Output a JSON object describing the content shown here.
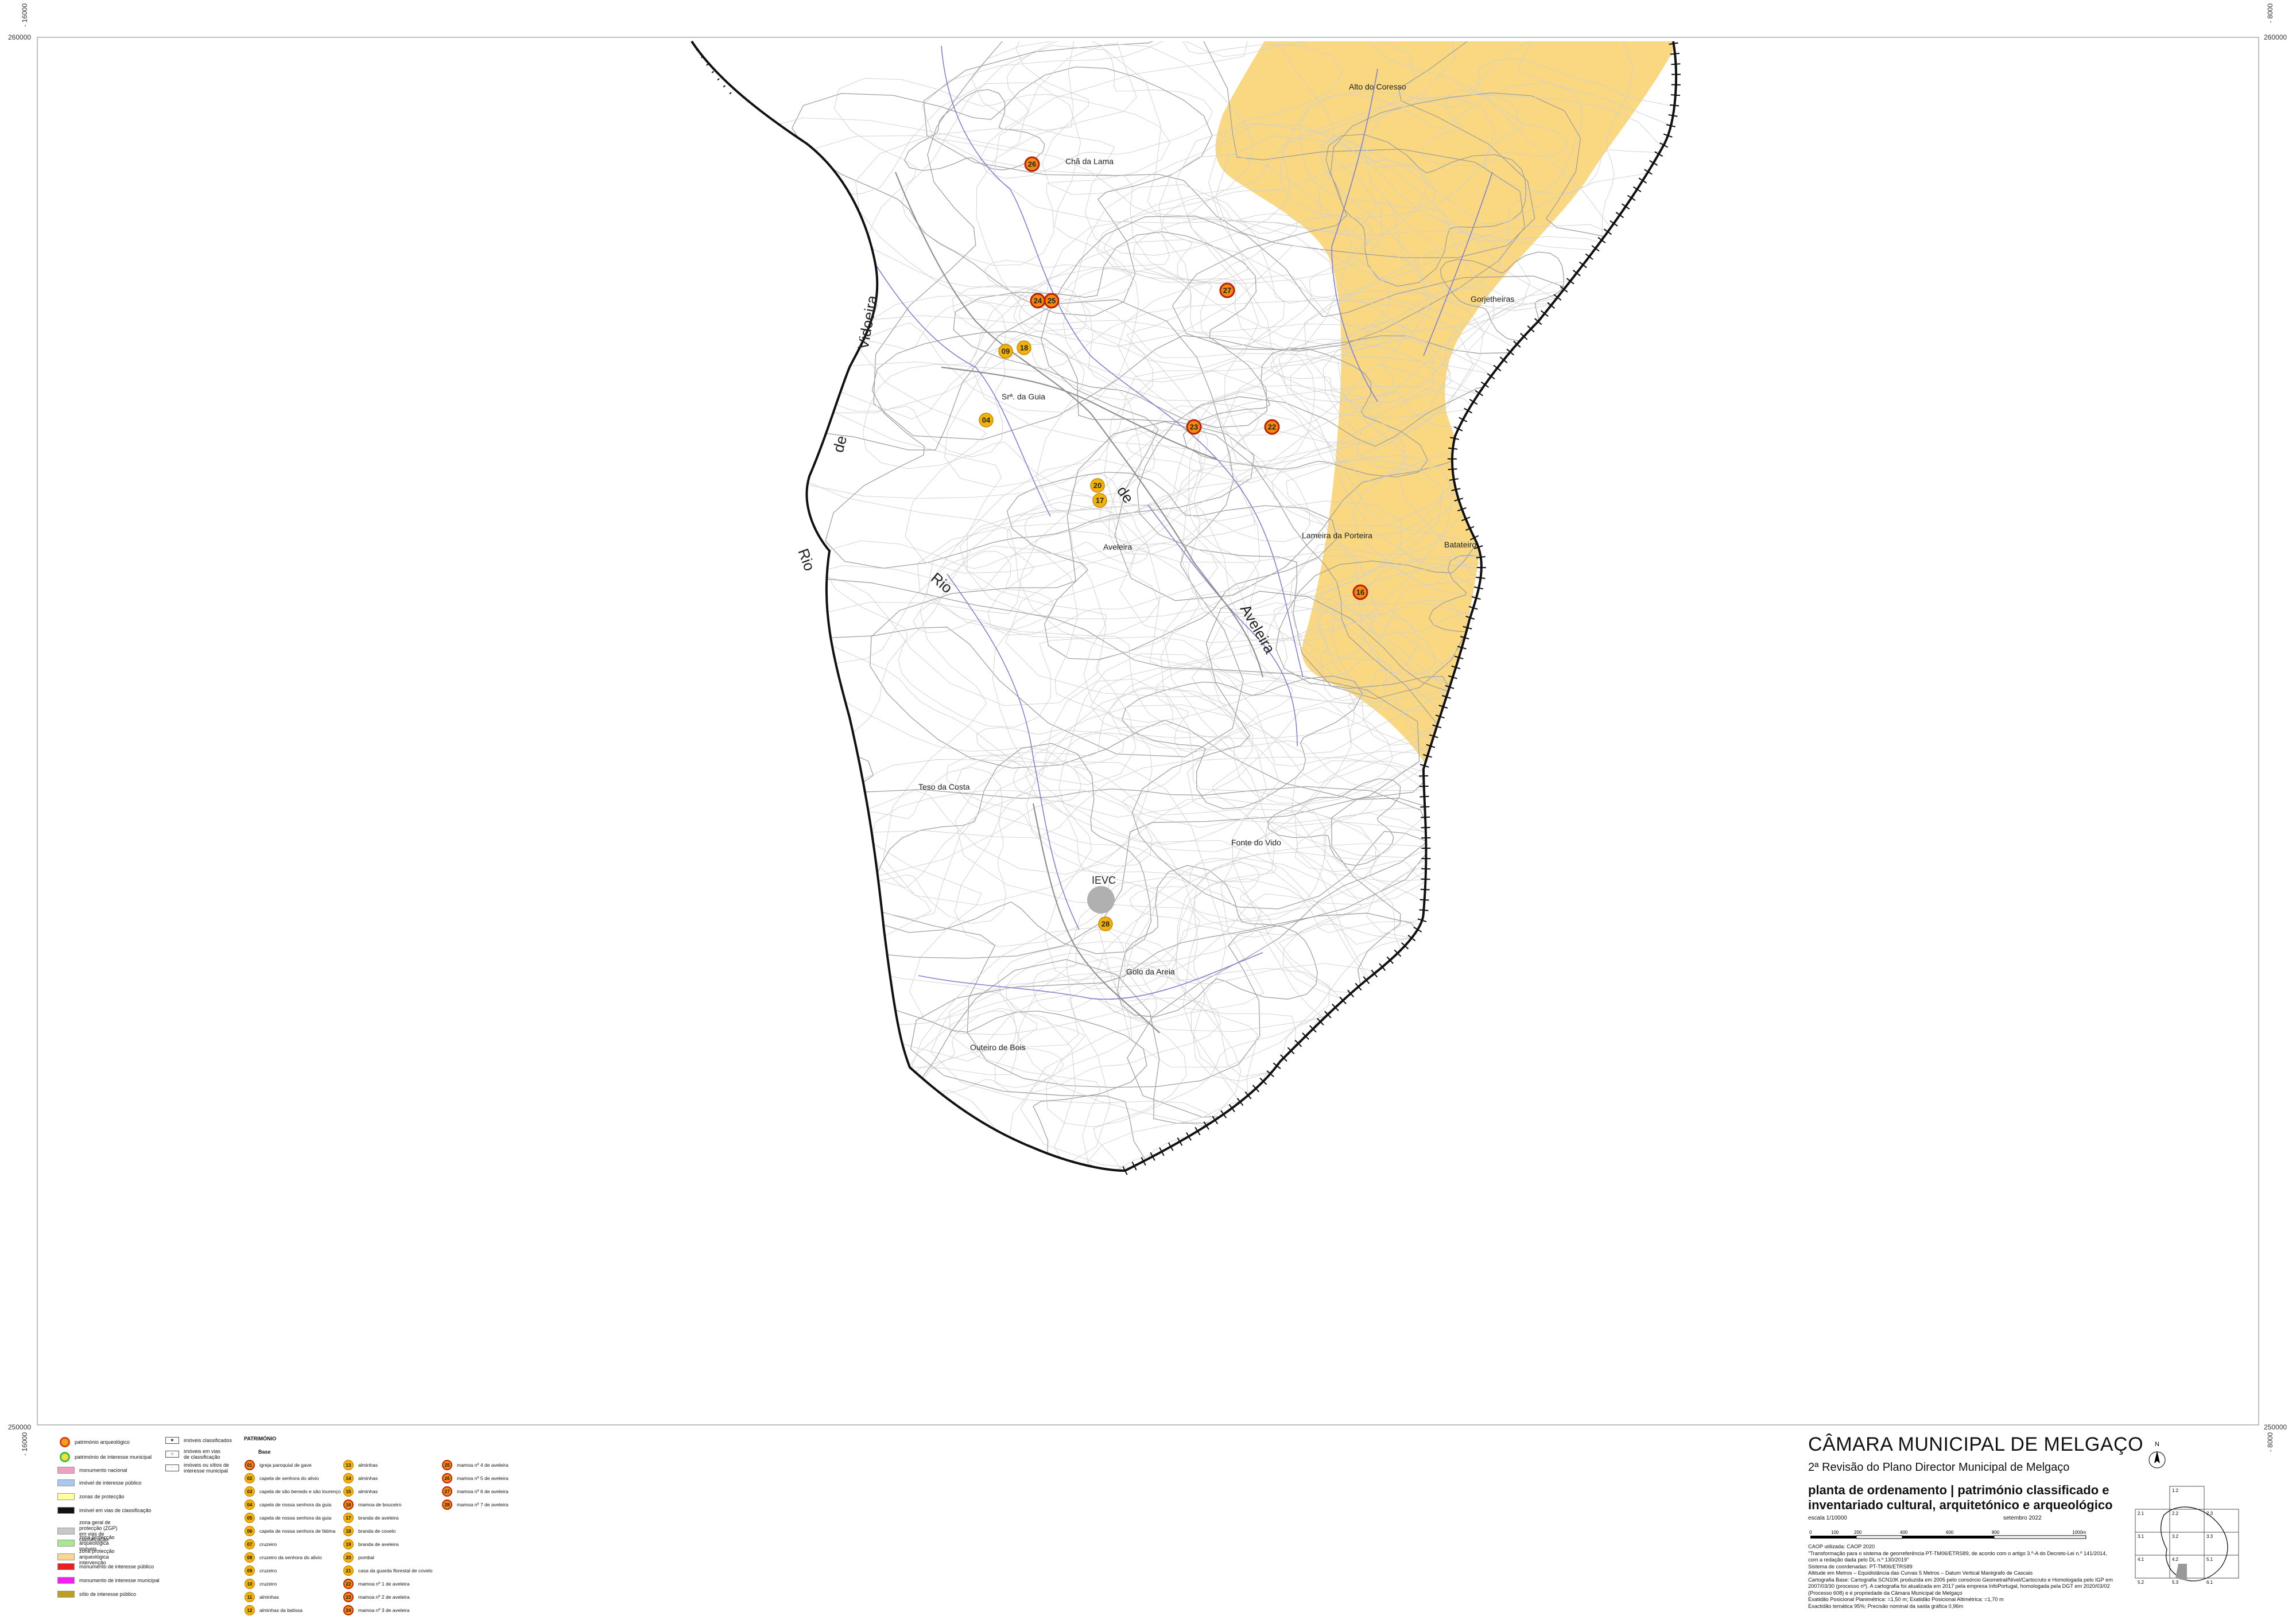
{
  "coords": {
    "top_left": "- 16000",
    "top_right": "- 8000",
    "left_top": "260000",
    "right_top": "260000",
    "left_bottom": "250000",
    "right_bottom": "250000",
    "bottom_left": "- 16000",
    "bottom_right": "- 8000"
  },
  "places": {
    "alto_coresso": "Alto do Coresso",
    "cha_lama": "Chã da Lama",
    "gorjetheiras": "Gorjetheiras",
    "srs_guia": "Srª. da Guia",
    "lameira_porteira": "Lameira da Porteira",
    "batateiro": "Batateiro",
    "aveleira_village": "Aveleira",
    "teso_costa": "Teso da Costa",
    "fonte_vido": "Fonte do Vido",
    "ievc": "IEVC",
    "golo_areia": "Golo da Areia",
    "outeiro_bois": "Outeiro de Bois"
  },
  "rivers": {
    "vidoeira": "Vidoeira",
    "de_a": "de",
    "rio_a": "Rio",
    "rio_b": "Rio",
    "de_b": "de",
    "aveleira": "Aveleira"
  },
  "markers": [
    {
      "code": "26",
      "kind": "arq"
    },
    {
      "code": "27",
      "kind": "arq"
    },
    {
      "code": "24",
      "kind": "arq"
    },
    {
      "code": "25",
      "kind": "arq"
    },
    {
      "code": "09",
      "kind": "pat"
    },
    {
      "code": "18",
      "kind": "pat"
    },
    {
      "code": "04",
      "kind": "pat"
    },
    {
      "code": "23",
      "kind": "arq"
    },
    {
      "code": "22",
      "kind": "arq"
    },
    {
      "code": "20",
      "kind": "pat"
    },
    {
      "code": "17",
      "kind": "pat"
    },
    {
      "code": "16",
      "kind": "arq"
    },
    {
      "code": "28",
      "kind": "pat"
    }
  ],
  "legend": {
    "rows": [
      "património arqueológico",
      "património de interesse municipal",
      "monumento nacional",
      "imóvel de interesse público",
      "zonas de protecção",
      "imóvel em vias de classificação",
      "zona geral de protecção (ZGP) em vias de classificação",
      "zona protecção arqueológica imóveis",
      "zona protecção arqueológica intervenção",
      "monumento de interesse público",
      "monumento de interesse municipal",
      "sítio de interesse público"
    ],
    "col2": [
      "imóveis classificados",
      "imóveis em vias de classificação",
      "imóveis ou sítios de interesse municipal"
    ],
    "colors": {
      "monumento_nacional": "#f0a0c0",
      "interesse_publico": "#a8c8f0",
      "zonas_proteccao": "#ffffa0",
      "vias_classificacao": "#111111",
      "zgp": "#c8c8c8",
      "arq_imoveis": "#a8e890",
      "arq_intervencao": "#f8d890",
      "mon_interesse_publico": "#e82020",
      "mon_interesse_municipal": "#f020f0",
      "sitio": "#b8a020",
      "zone_fill": "#f9d67a"
    },
    "patrimonio_title": "PATRIMÓNIO",
    "patrimonio_sub": "Base",
    "items": [
      {
        "code": "01",
        "label": "igreja paroquial de gave",
        "kind": "arq"
      },
      {
        "code": "02",
        "label": "capela de senhora do alivio",
        "kind": "pat"
      },
      {
        "code": "03",
        "label": "capela de são benedo e são lourenço",
        "kind": "pat"
      },
      {
        "code": "04",
        "label": "capela de nossa senhora da guia",
        "kind": "pat"
      },
      {
        "code": "05",
        "label": "capela de nossa senhora da guia",
        "kind": "pat"
      },
      {
        "code": "06",
        "label": "capela de nossa senhora de fátima",
        "kind": "pat"
      },
      {
        "code": "07",
        "label": "cruzeiro",
        "kind": "pat"
      },
      {
        "code": "08",
        "label": "cruzeiro da senhora do alivio",
        "kind": "pat"
      },
      {
        "code": "09",
        "label": "cruzeiro",
        "kind": "pat"
      },
      {
        "code": "10",
        "label": "cruzeiro",
        "kind": "pat"
      },
      {
        "code": "11",
        "label": "alminhas",
        "kind": "pat"
      },
      {
        "code": "12",
        "label": "alminhas da batissa",
        "kind": "pat"
      },
      {
        "code": "13",
        "label": "alminhas",
        "kind": "pat"
      },
      {
        "code": "14",
        "label": "alminhas",
        "kind": "pat"
      },
      {
        "code": "15",
        "label": "alminhas",
        "kind": "pat"
      },
      {
        "code": "16",
        "label": "mamoa de bouceiro",
        "kind": "arq"
      },
      {
        "code": "17",
        "label": "branda de aveleira",
        "kind": "pat"
      },
      {
        "code": "18",
        "label": "branda de covelo",
        "kind": "pat"
      },
      {
        "code": "19",
        "label": "branda de aveleira",
        "kind": "pat"
      },
      {
        "code": "20",
        "label": "pombal",
        "kind": "pat"
      },
      {
        "code": "21",
        "label": "casa da guarda florestal de covelo",
        "kind": "pat"
      },
      {
        "code": "22",
        "label": "mamoa nº 1 de aveleira",
        "kind": "arq"
      },
      {
        "code": "23",
        "label": "mamoa nº 2 de aveleira",
        "kind": "arq"
      },
      {
        "code": "24",
        "label": "mamoa nº 3 de aveleira",
        "kind": "arq"
      },
      {
        "code": "25",
        "label": "mamoa nº 4 de aveleira",
        "kind": "arq"
      },
      {
        "code": "26",
        "label": "mamoa nº 5 de aveleira",
        "kind": "arq"
      },
      {
        "code": "27",
        "label": "mamoa nº 6 de aveleira",
        "kind": "arq"
      },
      {
        "code": "28",
        "label": "mamoa nº 7 de aveleira",
        "kind": "arq"
      }
    ]
  },
  "title_block": {
    "org": "CÂMARA MUNICIPAL DE MELGAÇO",
    "revision": "2ª Revisão do Plano Director Municipal de Melgaço",
    "plan_title": "planta de ordenamento | património classificado e inventariado cultural, arquitetónico e arqueológico",
    "scale": "escala 1/10000",
    "date": "setembro 2022",
    "scale_ticks": [
      "0",
      "100",
      "200",
      "400",
      "600",
      "800",
      "1000m"
    ],
    "notes": [
      "CAOP utilizada: CAOP 2020",
      "\"Transformação para o sistema de georreferência PT-TM06/ETRS89, de acordo com o artigo 3.º-A do Decreto-Lei n.º 141/2014, com a redação dada pelo DL n.º 130/2019\"",
      "Sistema de coordenadas: PT-TM06/ETRS89",
      "Altitude em Metros – Equidistância das Curvas 5 Metros – Datum Vertical Marégrafo de Cascais",
      "Cartografia Base: Cartografia SCN10K produzida em 2005 pelo consórcio Geometral/Nível/Cartocruto e Homologada pelo IGP em 2007/03/30 (processo nº). A cartografia foi atualizada em 2017 pela empresa InfoPortugal, homologada pela DGT em 2020/03/02 (Processo 608) e é propriedade da Câmara Municipal de Melgaço",
      "Exatidão Posicional Planimétrica: =1,50 m; Exatidão Posicional Altimétrica: =1,70 m",
      "Exactidão temática 95%; Precisão nominal da saída gráfica 0,96m"
    ],
    "north": "N",
    "keymap_labels": [
      "1.2",
      "2.1",
      "2.2",
      "2.3",
      "3.1",
      "3.2",
      "3.3",
      "4.1",
      "4.2",
      "5.1",
      "5.2",
      "5.3",
      "6.1"
    ]
  }
}
